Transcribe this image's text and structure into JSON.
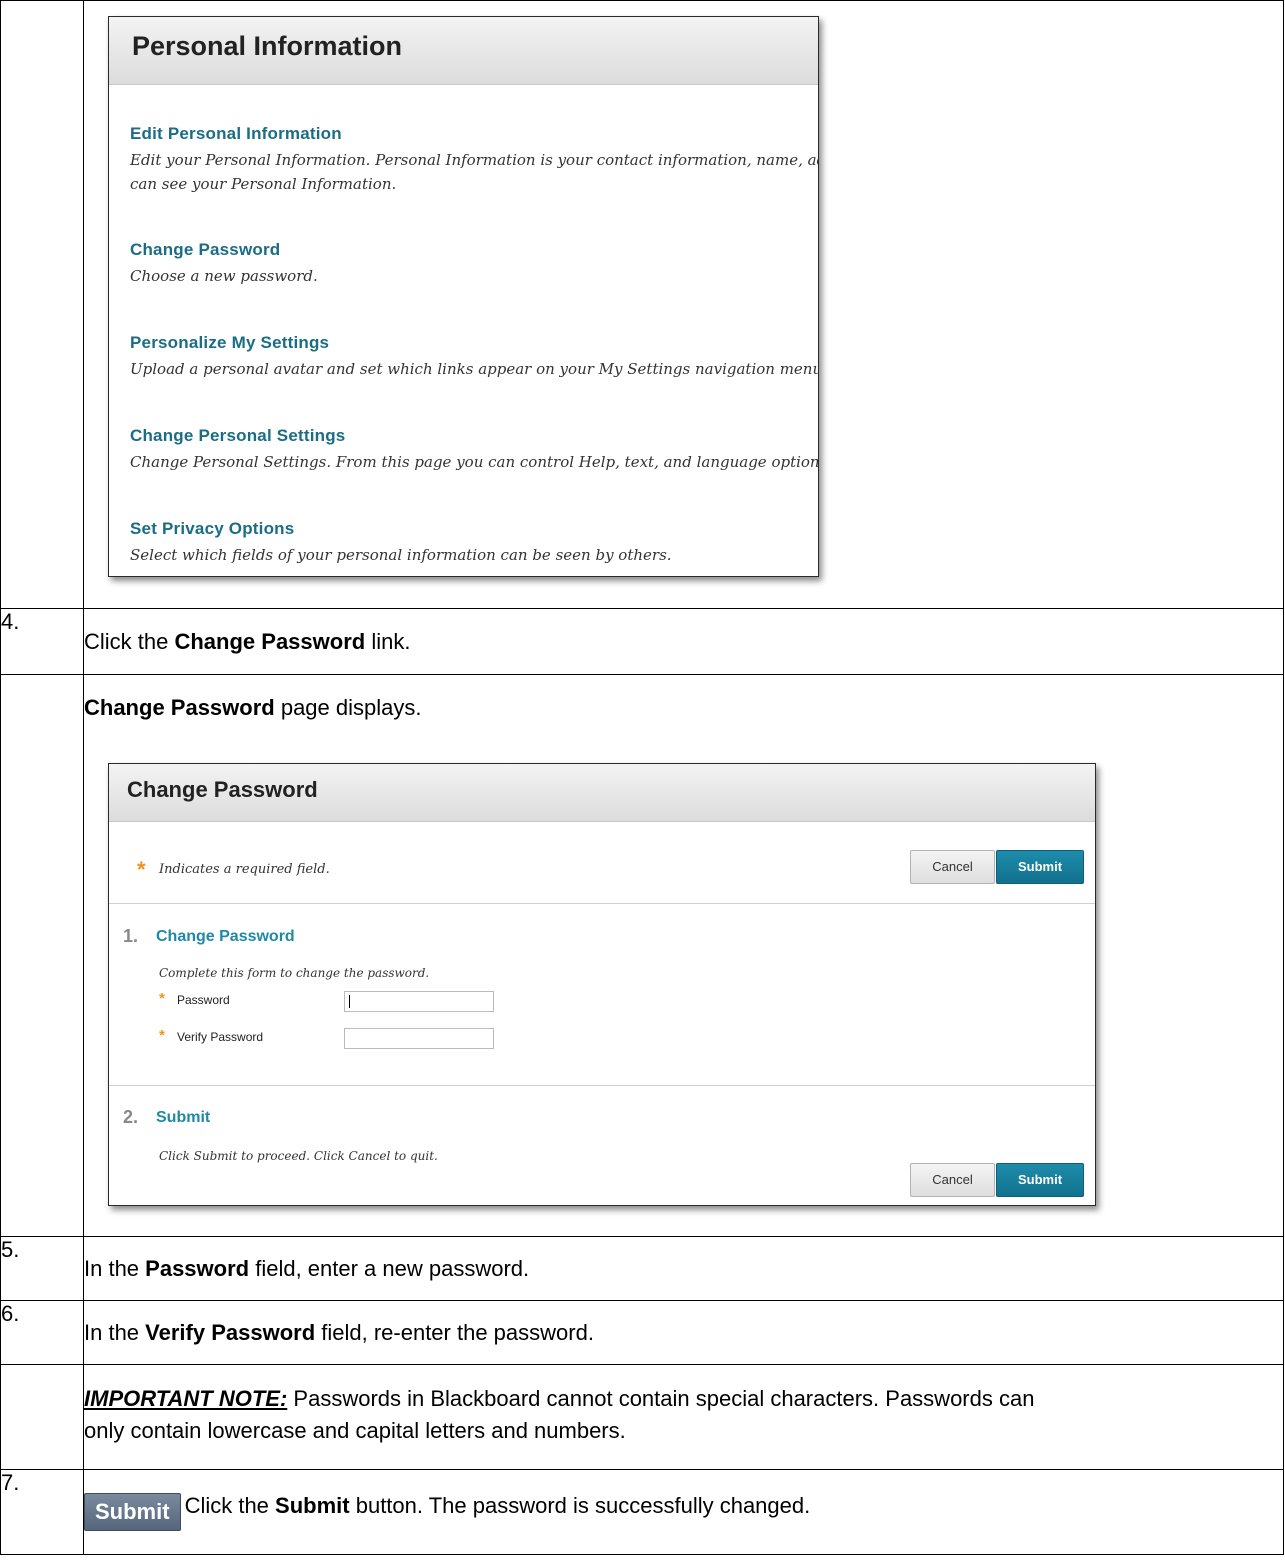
{
  "personal_info": {
    "title": "Personal Information",
    "items": [
      {
        "link": "Edit Personal Information",
        "desc1": "Edit your Personal Information. Personal Information is your contact information, name, ad",
        "desc2": "can see your Personal Information."
      },
      {
        "link": "Change Password",
        "desc1": "Choose a new password."
      },
      {
        "link": "Personalize My Settings",
        "desc1": "Upload a personal avatar and set which links appear on your My Settings navigation menu."
      },
      {
        "link": "Change Personal Settings",
        "desc1": "Change Personal Settings. From this page you can control Help, text, and language options."
      },
      {
        "link": "Set Privacy Options",
        "desc1": "Select which fields of your personal information can be seen by others."
      }
    ]
  },
  "steps": {
    "s4": {
      "num": "4.",
      "pre": "Click the ",
      "bold": "Change Password",
      "post": " link."
    },
    "displays": {
      "bold": "Change Password",
      "post": " page displays."
    },
    "s5": {
      "num": "5.",
      "pre": "In the ",
      "bold": "Password",
      "post": " field, enter a new password."
    },
    "s6": {
      "num": "6.",
      "pre": "In the ",
      "bold": "Verify Password",
      "post": " field, re-enter the password."
    },
    "note": {
      "label": "IMPORTANT NOTE:",
      "line1": " Passwords in Blackboard cannot contain special characters. Passwords can",
      "line2": "only contain lowercase and capital letters and numbers."
    },
    "s7": {
      "num": "7.",
      "button_img": "Submit",
      "pre": "Click the ",
      "bold": "Submit",
      "post": " button. The password is successfully changed."
    }
  },
  "change_password": {
    "title": "Change Password",
    "required_star": "*",
    "required_note": "Indicates a required field.",
    "cancel": "Cancel",
    "submit": "Submit",
    "section1_num": "1.",
    "section1_title": "Change Password",
    "section1_instr": "Complete this form to change the password.",
    "password_label": "Password",
    "verify_label": "Verify Password",
    "section2_num": "2.",
    "section2_title": "Submit",
    "section2_instr": "Click Submit to proceed. Click Cancel to quit."
  }
}
